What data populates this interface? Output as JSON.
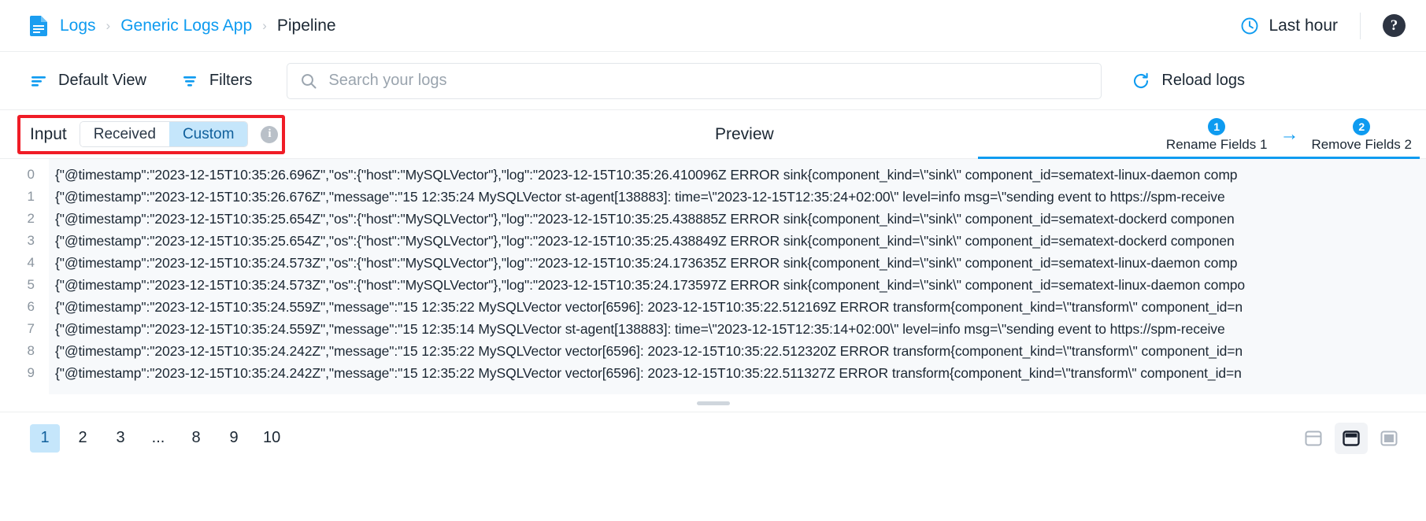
{
  "header": {
    "app_icon": "document-icon",
    "breadcrumb": [
      {
        "label": "Logs",
        "type": "link"
      },
      {
        "label": "Generic Logs App",
        "type": "link"
      },
      {
        "label": "Pipeline",
        "type": "current"
      }
    ],
    "separator": "›",
    "time_range": {
      "icon": "clock-icon",
      "label": "Last hour"
    },
    "help": {
      "icon": "help-icon",
      "glyph": "?"
    }
  },
  "toolbar": {
    "default_view": {
      "icon": "list-view-icon",
      "label": "Default View"
    },
    "filters": {
      "icon": "filter-icon",
      "label": "Filters"
    },
    "search": {
      "icon": "search-icon",
      "placeholder": "Search your logs",
      "value": ""
    },
    "reload": {
      "icon": "reload-icon",
      "label": "Reload logs"
    }
  },
  "section": {
    "input_label": "Input",
    "segments": [
      {
        "label": "Received",
        "selected": false
      },
      {
        "label": "Custom",
        "selected": true
      }
    ],
    "info_icon": "info-icon",
    "info_glyph": "i",
    "preview_label": "Preview",
    "highlight_color": "#f01c26",
    "steps": [
      {
        "badge": "1",
        "label": "Rename Fields 1"
      },
      {
        "badge": "2",
        "label": "Remove Fields 2"
      }
    ],
    "step_arrow": "→",
    "accent_color": "#0e9bf0"
  },
  "log": {
    "line_numbers": [
      "0",
      "1",
      "2",
      "3",
      "4",
      "5",
      "6",
      "7",
      "8",
      "9"
    ],
    "lines": [
      "{\"@timestamp\":\"2023-12-15T10:35:26.696Z\",\"os\":{\"host\":\"MySQLVector\"},\"log\":\"2023-12-15T10:35:26.410096Z ERROR sink{component_kind=\\\"sink\\\" component_id=sematext-linux-daemon comp",
      "{\"@timestamp\":\"2023-12-15T10:35:26.676Z\",\"message\":\"15 12:35:24 MySQLVector st-agent[138883]: time=\\\"2023-12-15T12:35:24+02:00\\\" level=info msg=\\\"sending event to https://spm-receive",
      "{\"@timestamp\":\"2023-12-15T10:35:25.654Z\",\"os\":{\"host\":\"MySQLVector\"},\"log\":\"2023-12-15T10:35:25.438885Z ERROR sink{component_kind=\\\"sink\\\" component_id=sematext-dockerd componen",
      "{\"@timestamp\":\"2023-12-15T10:35:25.654Z\",\"os\":{\"host\":\"MySQLVector\"},\"log\":\"2023-12-15T10:35:25.438849Z ERROR sink{component_kind=\\\"sink\\\" component_id=sematext-dockerd componen",
      "{\"@timestamp\":\"2023-12-15T10:35:24.573Z\",\"os\":{\"host\":\"MySQLVector\"},\"log\":\"2023-12-15T10:35:24.173635Z ERROR sink{component_kind=\\\"sink\\\" component_id=sematext-linux-daemon comp",
      "{\"@timestamp\":\"2023-12-15T10:35:24.573Z\",\"os\":{\"host\":\"MySQLVector\"},\"log\":\"2023-12-15T10:35:24.173597Z ERROR sink{component_kind=\\\"sink\\\" component_id=sematext-linux-daemon compo",
      "{\"@timestamp\":\"2023-12-15T10:35:24.559Z\",\"message\":\"15 12:35:22 MySQLVector vector[6596]: 2023-12-15T10:35:22.512169Z ERROR transform{component_kind=\\\"transform\\\" component_id=n",
      "{\"@timestamp\":\"2023-12-15T10:35:24.559Z\",\"message\":\"15 12:35:14 MySQLVector st-agent[138883]: time=\\\"2023-12-15T12:35:14+02:00\\\" level=info msg=\\\"sending event to https://spm-receive",
      "{\"@timestamp\":\"2023-12-15T10:35:24.242Z\",\"message\":\"15 12:35:22 MySQLVector vector[6596]: 2023-12-15T10:35:22.512320Z ERROR transform{component_kind=\\\"transform\\\" component_id=n",
      "{\"@timestamp\":\"2023-12-15T10:35:24.242Z\",\"message\":\"15 12:35:22 MySQLVector vector[6596]: 2023-12-15T10:35:22.511327Z ERROR transform{component_kind=\\\"transform\\\" component_id=n"
    ]
  },
  "footer": {
    "pages": [
      {
        "label": "1",
        "active": true
      },
      {
        "label": "2",
        "active": false
      },
      {
        "label": "3",
        "active": false
      },
      {
        "label": "...",
        "active": false,
        "dots": true
      },
      {
        "label": "8",
        "active": false
      },
      {
        "label": "9",
        "active": false
      },
      {
        "label": "10",
        "active": false
      }
    ],
    "layout_options": [
      {
        "icon": "layout-top-panel-icon",
        "selected": false
      },
      {
        "icon": "layout-split-panel-icon",
        "selected": true
      },
      {
        "icon": "layout-full-panel-icon",
        "selected": false
      }
    ]
  }
}
